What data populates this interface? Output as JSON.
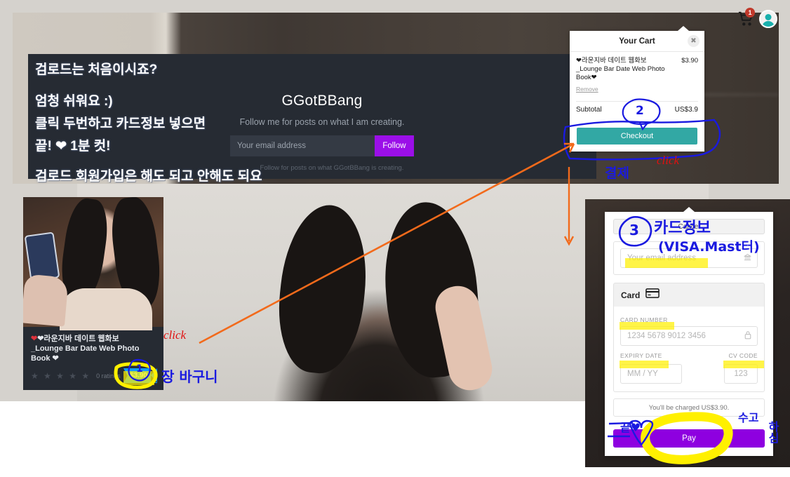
{
  "header": {
    "cart_badge": "1",
    "cart_icon": "shopping-cart-icon",
    "avatar_icon": "user-avatar-icon"
  },
  "promo_overlay": {
    "line1": "검로드는 처음이시죠?",
    "line2": "엄청 쉬워요 :)",
    "line3": "클릭 두번하고 카드정보 넣으면",
    "line4": "끝! ❤   1분 컷!",
    "line5": "검로드 회원가입은 해도 되고 안해도 되요"
  },
  "profile": {
    "name": "GGotBBang",
    "tagline": "Follow me for posts on what I am creating.",
    "email_placeholder": "Your email address",
    "follow_label": "Follow",
    "follow_note": "Follow for posts on what GGotBBang is creating."
  },
  "product_card": {
    "title_line1": "❤라운지바 데이트 웹화보",
    "title_line2": "_Lounge Bar Date Web Photo",
    "title_line3": "Book ❤",
    "stars": "★ ★ ★ ★ ★",
    "ratings": "0 ratings",
    "price": "$3.90"
  },
  "cart": {
    "title": "Your Cart",
    "close_label": "✖",
    "item_name": "❤라운지바 데이트 웹화보 _Lounge Bar Date Web Photo Book❤",
    "item_price": "$3.90",
    "remove_label": "Remove",
    "subtotal_label": "Subtotal",
    "subtotal_value": "US$3.9",
    "checkout_label": "Checkout"
  },
  "payment": {
    "cancel_label": "Cancel",
    "email_placeholder": "Your email address",
    "email_icon": "bank-icon",
    "card_section_label": "Card",
    "card_icon": "credit-card-icon",
    "card_number_label": "CARD NUMBER",
    "card_number_placeholder": "1234 5678 9012 3456",
    "card_lock_icon": "lock-icon",
    "expiry_label": "EXPIRY DATE",
    "expiry_placeholder": "MM / YY",
    "cvc_label": "CV CODE",
    "cvc_placeholder": "123",
    "charge_note": "You'll be charged US$3.90.",
    "pay_label": "Pay"
  },
  "annotations": {
    "step1": "1",
    "step2": "2",
    "step3": "3",
    "click_cart": "click",
    "click_checkout": "click",
    "cart_ko": "장 바구니",
    "checkout_ko": "결제",
    "card_ko": "카드정보",
    "card_ko2": "(VISA.Mast터)",
    "end_ko": "끝♥",
    "thanks_ko_1": "수고",
    "thanks_ko_2": "하심"
  },
  "colors": {
    "dark_panel": "#262b33",
    "follow_purple": "#9b0fe8",
    "checkout_teal": "#32a8a4",
    "pay_purple": "#8e00e0",
    "price_blue": "#0f9bff",
    "badge_red": "#c0392b",
    "ink_blue": "#1a1ae0",
    "ink_red": "#e01010",
    "highlight_yellow": "#fff000",
    "arrow_orange": "#f26a1b"
  }
}
